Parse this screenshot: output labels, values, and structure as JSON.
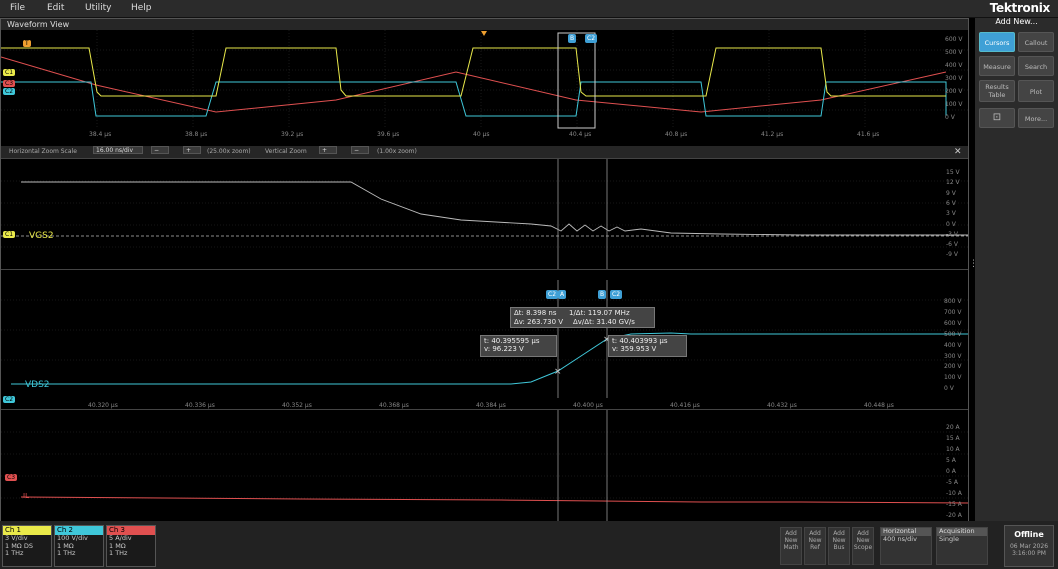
{
  "menu": {
    "items": [
      "File",
      "Edit",
      "Utility",
      "Help"
    ],
    "brand": "Tektronix"
  },
  "waveform_view": {
    "title": "Waveform View"
  },
  "overview": {
    "time_labels": [
      "38.4 µs",
      "38.8 µs",
      "39.2 µs",
      "39.6 µs",
      "40 µs",
      "40.4 µs",
      "40.8 µs",
      "41.2 µs",
      "41.6 µs"
    ],
    "right_labels": [
      "600 V",
      "500 V",
      "400 V",
      "300 V",
      "200 V",
      "100 V",
      "0 V"
    ],
    "ch_tags": [
      "T",
      "C1",
      "C3",
      "C2"
    ]
  },
  "zoom_bar": {
    "hz_label": "Horizontal Zoom Scale",
    "hz_value": "16.00 ns/div",
    "hz_zoom": "(25.00x zoom)",
    "vz_label": "Vertical Zoom",
    "vz_zoom": "(1.00x zoom)"
  },
  "pane1": {
    "label": "VGS2",
    "tag": "C1",
    "axis": [
      "15 V",
      "12 V",
      "9 V",
      "6 V",
      "3 V",
      "0 V",
      "-3 V",
      "-6 V",
      "-9 V"
    ]
  },
  "pane2": {
    "label": "VDS2",
    "tag": "C2",
    "axis": [
      "800 V",
      "700 V",
      "600 V",
      "500 V",
      "400 V",
      "300 V",
      "200 V",
      "100 V",
      "0 V"
    ],
    "time_labels": [
      "40.320 µs",
      "40.336 µs",
      "40.352 µs",
      "40.368 µs",
      "40.384 µs",
      "40.400 µs",
      "40.416 µs",
      "40.432 µs",
      "40.448 µs"
    ]
  },
  "pane3": {
    "label": "IL",
    "tag": "C3",
    "axis": [
      "20 A",
      "15 A",
      "10 A",
      "5 A",
      "0 A",
      "-5 A",
      "-10 A",
      "-15 A",
      "-20 A"
    ]
  },
  "cursors": {
    "a_tag": "A",
    "b_tag": "B",
    "ch_tag": "C2",
    "delta": {
      "dt": "Δt:  8.398 ns",
      "inv_dt": "1/Δt:  119.07 MHz",
      "dv": "Δv:  263.730 V",
      "dvdt": "Δv/Δt:  31.40 GV/s"
    },
    "a": {
      "t": "t:  40.395595 µs",
      "v": "v:  96.223 V"
    },
    "b": {
      "t": "t:  40.403993 µs",
      "v": "v:  359.953 V"
    }
  },
  "right_panel": {
    "add_new": "Add New...",
    "buttons": [
      {
        "label": "Cursors",
        "active": true
      },
      {
        "label": "Callout",
        "active": false
      },
      {
        "label": "Measure",
        "active": false
      },
      {
        "label": "Search",
        "active": false
      },
      {
        "label": "Results Table",
        "active": false
      },
      {
        "label": "Plot",
        "active": false
      },
      {
        "label": "",
        "active": false
      },
      {
        "label": "More...",
        "active": false
      }
    ]
  },
  "channels": [
    {
      "name": "Ch 1",
      "scale": "3 V/div",
      "imp": "1 MΩ  DS",
      "bw": "1 THz",
      "color": "#e9e94a"
    },
    {
      "name": "Ch 2",
      "scale": "100 V/div",
      "imp": "1 MΩ",
      "bw": "1 THz",
      "color": "#3fc7d9"
    },
    {
      "name": "Ch 3",
      "scale": "5 A/div",
      "imp": "1 MΩ",
      "bw": "1 THz",
      "color": "#e05050"
    }
  ],
  "bottom_buttons": [
    "Add New Math",
    "Add New Ref",
    "Add New Bus",
    "Add New Scope"
  ],
  "horizontal": {
    "title": "Horizontal",
    "value": "400 ns/div"
  },
  "acquisition": {
    "title": "Acquisition",
    "value": "Single"
  },
  "status": {
    "state": "Offline",
    "date": "06 Mar 2026",
    "time": "3:16:00 PM"
  },
  "colors": {
    "ch1": "#e9e94a",
    "ch2": "#3fc7d9",
    "ch3": "#e05050",
    "accent": "#3fa0d6",
    "trigger": "#f0a030"
  }
}
